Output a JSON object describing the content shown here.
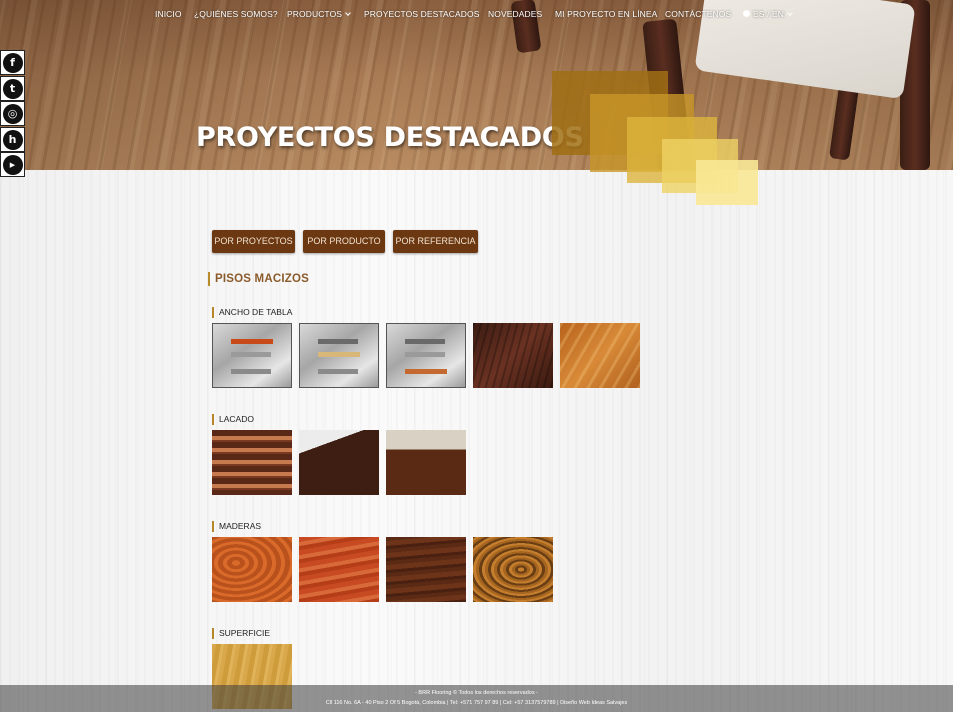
{
  "nav": {
    "items": [
      "INICIO",
      "¿QUIÉNES SOMOS?",
      "PRODUCTOS",
      "PROYECTOS DESTACADOS",
      "NOVEDADES",
      "MI PROYECTO EN LÍNEA",
      "CONTÁCTENOS"
    ],
    "language": "ES / EN"
  },
  "hero": {
    "title": "PROYECTOS DESTACADOS"
  },
  "social": [
    "facebook",
    "twitter",
    "instagram",
    "houzz",
    "youtube"
  ],
  "filters": {
    "projects": "POR PROYECTOS",
    "product": "POR PRODUCTO",
    "reference": "POR REFERENCIA"
  },
  "section": {
    "title": "PISOS MACIZOS",
    "groups": [
      {
        "title": "ANCHO DE TABLA",
        "count": 5
      },
      {
        "title": "LACADO",
        "count": 3
      },
      {
        "title": "MADERAS",
        "count": 4
      },
      {
        "title": "SUPERFICIE",
        "count": 1
      }
    ]
  },
  "footer": {
    "line1": "- BRR Flooring © Todos los derechos reservados -",
    "line2": "Cll 116 No. 6A - 40 Piso 2 Of 5 Bogotá, Colombia | Tel: +571 757 97 89 | Cel: +57 3137579789 | Diseño Web Ideas Salvajes"
  },
  "colors": {
    "button_bg": "#6b3812",
    "section_title": "#8a5a2a",
    "accent_gold": "#b88a2a"
  }
}
